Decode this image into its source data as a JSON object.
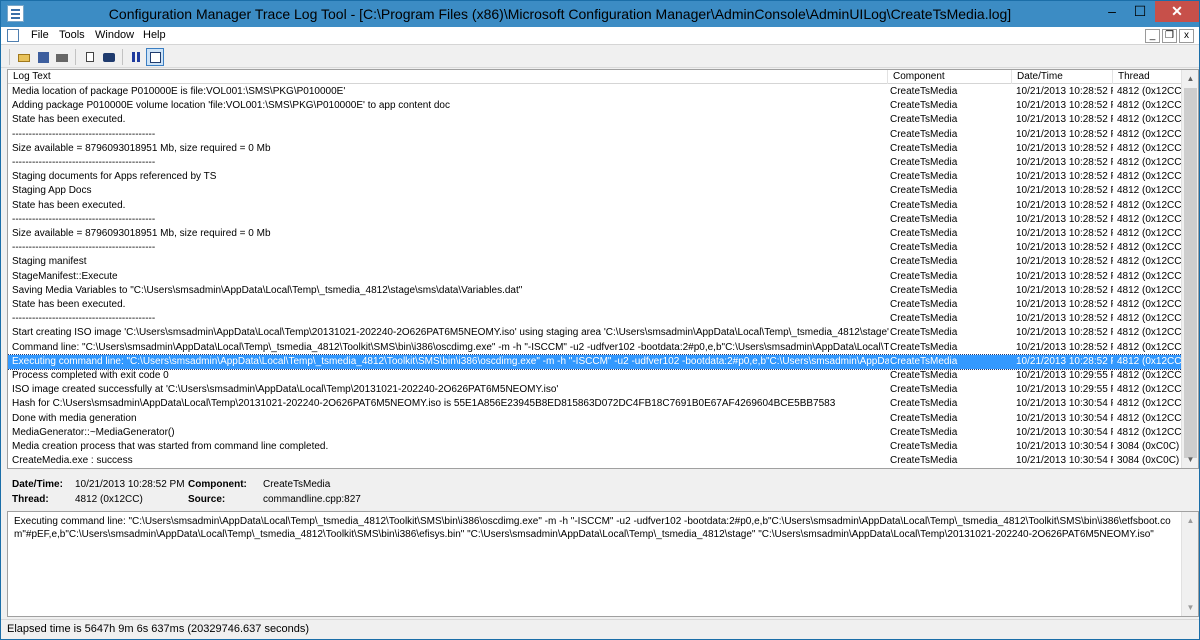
{
  "window": {
    "title": "Configuration Manager Trace Log Tool - [C:\\Program Files (x86)\\Microsoft Configuration Manager\\AdminConsole\\AdminUILog\\CreateTsMedia.log]",
    "minimize": "–",
    "maximize": "☐",
    "close": "✕"
  },
  "menu": {
    "items": [
      "File",
      "Tools",
      "Window",
      "Help"
    ],
    "mdi_minimize": "_",
    "mdi_restore": "❐",
    "mdi_close": "x"
  },
  "toolbar": {
    "icons": [
      "open-icon",
      "save-icon",
      "print-icon",
      "copy-icon",
      "find-icon",
      "pause-icon",
      "preview-pane-icon"
    ]
  },
  "columns": {
    "log_text": "Log Text",
    "component": "Component",
    "date_time": "Date/Time",
    "thread": "Thread"
  },
  "rows": [
    {
      "text": "Media location of package P010000E is file:VOL001:\\SMS\\PKG\\P010000E'",
      "component": "CreateTsMedia",
      "date": "10/21/2013 10:28:52 P",
      "thread": "4812 (0x12CC)"
    },
    {
      "text": "Adding package P010000E volume location 'file:VOL001:\\SMS\\PKG\\P010000E' to app content doc",
      "component": "CreateTsMedia",
      "date": "10/21/2013 10:28:52 P",
      "thread": "4812 (0x12CC)"
    },
    {
      "text": "State has been executed.",
      "component": "CreateTsMedia",
      "date": "10/21/2013 10:28:52 P",
      "thread": "4812 (0x12CC)"
    },
    {
      "text": "-------------------------------------------",
      "component": "CreateTsMedia",
      "date": "10/21/2013 10:28:52 P",
      "thread": "4812 (0x12CC)"
    },
    {
      "text": "Size available  = 8796093018951 Mb, size required = 0 Mb",
      "component": "CreateTsMedia",
      "date": "10/21/2013 10:28:52 P",
      "thread": "4812 (0x12CC)"
    },
    {
      "text": "-------------------------------------------",
      "component": "CreateTsMedia",
      "date": "10/21/2013 10:28:52 P",
      "thread": "4812 (0x12CC)"
    },
    {
      "text": "Staging documents for Apps referenced by TS",
      "component": "CreateTsMedia",
      "date": "10/21/2013 10:28:52 P",
      "thread": "4812 (0x12CC)"
    },
    {
      "text": "Staging App Docs",
      "component": "CreateTsMedia",
      "date": "10/21/2013 10:28:52 P",
      "thread": "4812 (0x12CC)"
    },
    {
      "text": "State has been executed.",
      "component": "CreateTsMedia",
      "date": "10/21/2013 10:28:52 P",
      "thread": "4812 (0x12CC)"
    },
    {
      "text": "-------------------------------------------",
      "component": "CreateTsMedia",
      "date": "10/21/2013 10:28:52 P",
      "thread": "4812 (0x12CC)"
    },
    {
      "text": "Size available  = 8796093018951 Mb, size required = 0 Mb",
      "component": "CreateTsMedia",
      "date": "10/21/2013 10:28:52 P",
      "thread": "4812 (0x12CC)"
    },
    {
      "text": "-------------------------------------------",
      "component": "CreateTsMedia",
      "date": "10/21/2013 10:28:52 P",
      "thread": "4812 (0x12CC)"
    },
    {
      "text": "Staging manifest",
      "component": "CreateTsMedia",
      "date": "10/21/2013 10:28:52 P",
      "thread": "4812 (0x12CC)"
    },
    {
      "text": "StageManifest::Execute",
      "component": "CreateTsMedia",
      "date": "10/21/2013 10:28:52 P",
      "thread": "4812 (0x12CC)"
    },
    {
      "text": "Saving Media Variables to \"C:\\Users\\smsadmin\\AppData\\Local\\Temp\\_tsmedia_4812\\stage\\sms\\data\\Variables.dat\"",
      "component": "CreateTsMedia",
      "date": "10/21/2013 10:28:52 P",
      "thread": "4812 (0x12CC)"
    },
    {
      "text": "State has been executed.",
      "component": "CreateTsMedia",
      "date": "10/21/2013 10:28:52 P",
      "thread": "4812 (0x12CC)"
    },
    {
      "text": "-------------------------------------------",
      "component": "CreateTsMedia",
      "date": "10/21/2013 10:28:52 P",
      "thread": "4812 (0x12CC)"
    },
    {
      "text": "Start creating ISO image 'C:\\Users\\smsadmin\\AppData\\Local\\Temp\\20131021-202240-2O626PAT6M5NEOMY.iso' using staging area 'C:\\Users\\smsadmin\\AppData\\Local\\Temp\\_tsmedia_4812\\stage'",
      "component": "CreateTsMedia",
      "date": "10/21/2013 10:28:52 P",
      "thread": "4812 (0x12CC)"
    },
    {
      "text": "Command line: \"C:\\Users\\smsadmin\\AppData\\Local\\Temp\\_tsmedia_4812\\Toolkit\\SMS\\bin\\i386\\oscdimg.exe\" -m -h \"-ISCCM\" -u2 -udfver102 -bootdata:2#p0,e,b\"C:\\Users\\smsadmin\\AppData\\Local\\Temp\\_tsmedia...",
      "component": "CreateTsMedia",
      "date": "10/21/2013 10:28:52 P",
      "thread": "4812 (0x12CC)"
    },
    {
      "text": "Executing command line: \"C:\\Users\\smsadmin\\AppData\\Local\\Temp\\_tsmedia_4812\\Toolkit\\SMS\\bin\\i386\\oscdimg.exe\" -m -h \"-ISCCM\" -u2 -udfver102 -bootdata:2#p0,e,b\"C:\\Users\\smsadmin\\AppData\\Local\\Temp\\...",
      "component": "CreateTsMedia",
      "date": "10/21/2013 10:28:52 P",
      "thread": "4812 (0x12CC)"
    },
    {
      "text": "Process completed with exit code 0",
      "component": "CreateTsMedia",
      "date": "10/21/2013 10:29:55 P",
      "thread": "4812 (0x12CC)"
    },
    {
      "text": "ISO image created successfully at 'C:\\Users\\smsadmin\\AppData\\Local\\Temp\\20131021-202240-2O626PAT6M5NEOMY.iso'",
      "component": "CreateTsMedia",
      "date": "10/21/2013 10:29:55 P",
      "thread": "4812 (0x12CC)"
    },
    {
      "text": "Hash for C:\\Users\\smsadmin\\AppData\\Local\\Temp\\20131021-202240-2O626PAT6M5NEOMY.iso is 55E1A856E23945B8ED815863D072DC4FB18C7691B0E67AF4269604BCE5BB7583",
      "component": "CreateTsMedia",
      "date": "10/21/2013 10:30:54 P",
      "thread": "4812 (0x12CC)"
    },
    {
      "text": "Done with media generation",
      "component": "CreateTsMedia",
      "date": "10/21/2013 10:30:54 P",
      "thread": "4812 (0x12CC)"
    },
    {
      "text": "MediaGenerator::~MediaGenerator()",
      "component": "CreateTsMedia",
      "date": "10/21/2013 10:30:54 P",
      "thread": "4812 (0x12CC)"
    },
    {
      "text": "Media creation process that was started from command line completed.",
      "component": "CreateTsMedia",
      "date": "10/21/2013 10:30:54 P",
      "thread": "3084 (0xC0C)"
    },
    {
      "text": "CreateMedia.exe : success",
      "component": "CreateTsMedia",
      "date": "10/21/2013 10:30:54 P",
      "thread": "3084 (0xC0C)"
    }
  ],
  "selected_row": 19,
  "details": {
    "date_label": "Date/Time:",
    "date_value": "10/21/2013 10:28:52 PM",
    "component_label": "Component:",
    "component_value": "CreateTsMedia",
    "thread_label": "Thread:",
    "thread_value": "4812 (0x12CC)",
    "source_label": "Source:",
    "source_value": "commandline.cpp:827"
  },
  "message": "Executing command line: \"C:\\Users\\smsadmin\\AppData\\Local\\Temp\\_tsmedia_4812\\Toolkit\\SMS\\bin\\i386\\oscdimg.exe\" -m -h \"-ISCCM\" -u2 -udfver102 -bootdata:2#p0,e,b\"C:\\Users\\smsadmin\\AppData\\Local\\Temp\\_tsmedia_4812\\Toolkit\\SMS\\bin\\i386\\etfsboot.com\"#pEF,e,b\"C:\\Users\\smsadmin\\AppData\\Local\\Temp\\_tsmedia_4812\\Toolkit\\SMS\\bin\\i386\\efisys.bin\" \"C:\\Users\\smsadmin\\AppData\\Local\\Temp\\_tsmedia_4812\\stage\" \"C:\\Users\\smsadmin\\AppData\\Local\\Temp\\20131021-202240-2O626PAT6M5NEOMY.iso\"",
  "status": "Elapsed time is 5647h 9m 6s 637ms (20329746.637 seconds)",
  "colors": {
    "titlebar": "#3c8cc4",
    "selection": "#3399ff",
    "close_button": "#c7504a"
  }
}
